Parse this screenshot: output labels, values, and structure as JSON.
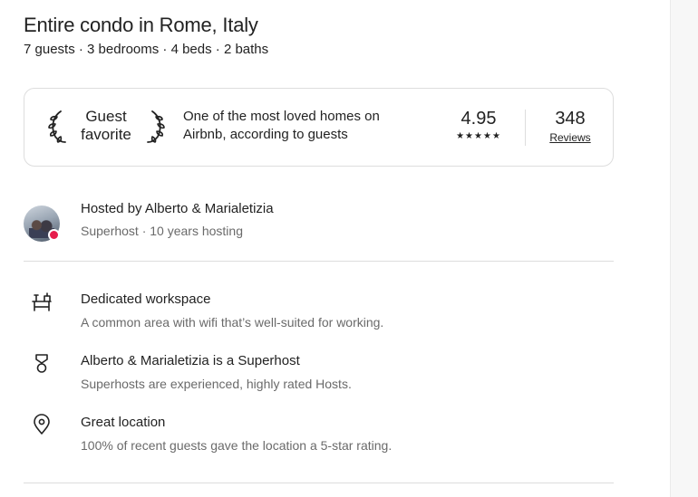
{
  "listing": {
    "title": "Entire condo in Rome, Italy",
    "summary": "7 guests · 3 bedrooms · 4 beds · 2 baths"
  },
  "badge": {
    "label_line1": "Guest",
    "label_line2": "favorite",
    "description_line1": "One of the most loved homes on",
    "description_line2": "Airbnb, according to guests",
    "rating": "4.95",
    "stars": "★★★★★",
    "reviews_count": "348",
    "reviews_label": "Reviews"
  },
  "host": {
    "name_line": "Hosted by Alberto & Marialetizia",
    "details": "Superhost · 10 years hosting",
    "superhost_color": "#e61e4d"
  },
  "highlights": [
    {
      "icon": "desk-icon",
      "title": "Dedicated workspace",
      "description": "A common area with wifi that’s well-suited for working."
    },
    {
      "icon": "superhost-medal-icon",
      "title": "Alberto & Marialetizia is a Superhost",
      "description": "Superhosts are experienced, highly rated Hosts."
    },
    {
      "icon": "location-pin-icon",
      "title": "Great location",
      "description": "100% of recent guests gave the location a 5-star rating."
    }
  ]
}
